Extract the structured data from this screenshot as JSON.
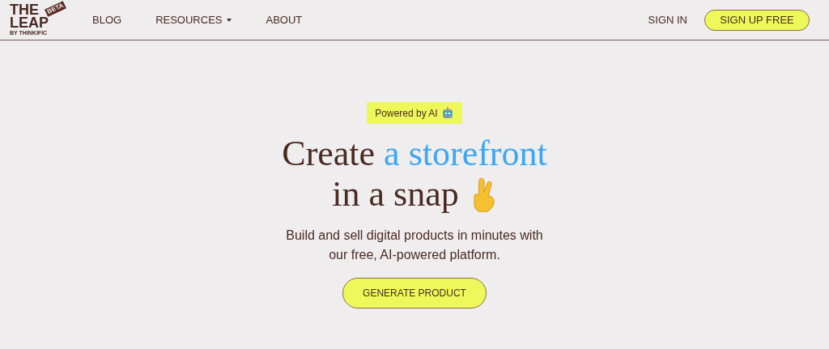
{
  "logo": {
    "line_1": "THE",
    "line_2": "LEAP",
    "badge": "BETA",
    "byline": "BY THINKIFIC"
  },
  "nav": [
    {
      "label": "BLOG",
      "dropdown": false
    },
    {
      "label": "RESOURCES",
      "dropdown": true
    },
    {
      "label": "ABOUT",
      "dropdown": false
    }
  ],
  "sign_in": "SIGN IN",
  "sign_up": "SIGN UP FREE",
  "hero": {
    "badge": "Powered by AI",
    "headline": [
      {
        "parts": [
          {
            "text": "Create",
            "highlight": false
          },
          {
            "text": "a storefront",
            "highlight": true
          }
        ]
      },
      {
        "parts": [
          {
            "text": "in a snap",
            "highlight": false
          }
        ]
      }
    ],
    "subtitle": "Build and sell digital products in minutes with our free, AI-powered platform.",
    "cta": "GENERATE PRODUCT"
  }
}
